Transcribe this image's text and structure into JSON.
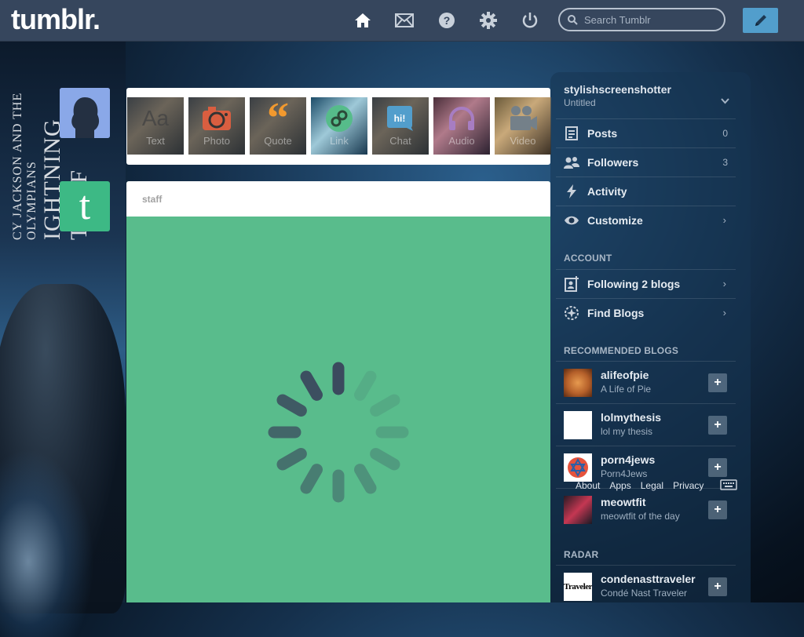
{
  "header": {
    "logo": "tumblr.",
    "search_placeholder": "Search Tumblr",
    "nav_icons": [
      "home-icon",
      "mail-icon",
      "help-icon",
      "gear-icon",
      "power-icon"
    ],
    "compose_icon": "pencil-icon"
  },
  "background": {
    "poster_line1": "CY JACKSON AND THE OLYMPIANS",
    "poster_line2": "IGHTNING THIEF"
  },
  "post_types": [
    {
      "label": "Text",
      "icon": "text-icon",
      "color": "#444444"
    },
    {
      "label": "Photo",
      "icon": "camera-icon",
      "color": "#d95e40"
    },
    {
      "label": "Quote",
      "icon": "quote-icon",
      "color": "#f2992e"
    },
    {
      "label": "Link",
      "icon": "link-icon",
      "color": "#56bc8a"
    },
    {
      "label": "Chat",
      "icon": "chat-icon",
      "color": "#529ecc"
    },
    {
      "label": "Audio",
      "icon": "headphones-icon",
      "color": "#a77dc2"
    },
    {
      "label": "Video",
      "icon": "video-icon",
      "color": "#748089"
    }
  ],
  "post": {
    "author": "staff",
    "loading": true,
    "background_color": "#59bc8c"
  },
  "sidebar": {
    "blog_name": "stylishscreenshotter",
    "blog_title": "Untitled",
    "items": [
      {
        "label": "Posts",
        "count": "0",
        "icon": "posts-icon"
      },
      {
        "label": "Followers",
        "count": "3",
        "icon": "followers-icon"
      },
      {
        "label": "Activity",
        "count": "",
        "icon": "lightning-icon"
      },
      {
        "label": "Customize",
        "count": "",
        "icon": "eye-icon"
      }
    ],
    "account_heading": "ACCOUNT",
    "account_items": [
      {
        "label": "Following 2 blogs",
        "icon": "following-icon"
      },
      {
        "label": "Find Blogs",
        "icon": "compass-icon"
      }
    ],
    "recommended_heading": "RECOMMENDED BLOGS",
    "recommended": [
      {
        "name": "alifeofpie",
        "title": "A Life of Pie"
      },
      {
        "name": "lolmythesis",
        "title": "lol my thesis"
      },
      {
        "name": "porn4jews",
        "title": "Porn4Jews"
      },
      {
        "name": "meowtfit",
        "title": "meowtfit of the day"
      }
    ],
    "radar_heading": "RADAR",
    "radar": [
      {
        "name": "condenasttraveler",
        "title": "Condé Nast Traveler",
        "thumb_text": "Traveler"
      }
    ],
    "footer_links": [
      "About",
      "Apps",
      "Legal",
      "Privacy"
    ]
  }
}
